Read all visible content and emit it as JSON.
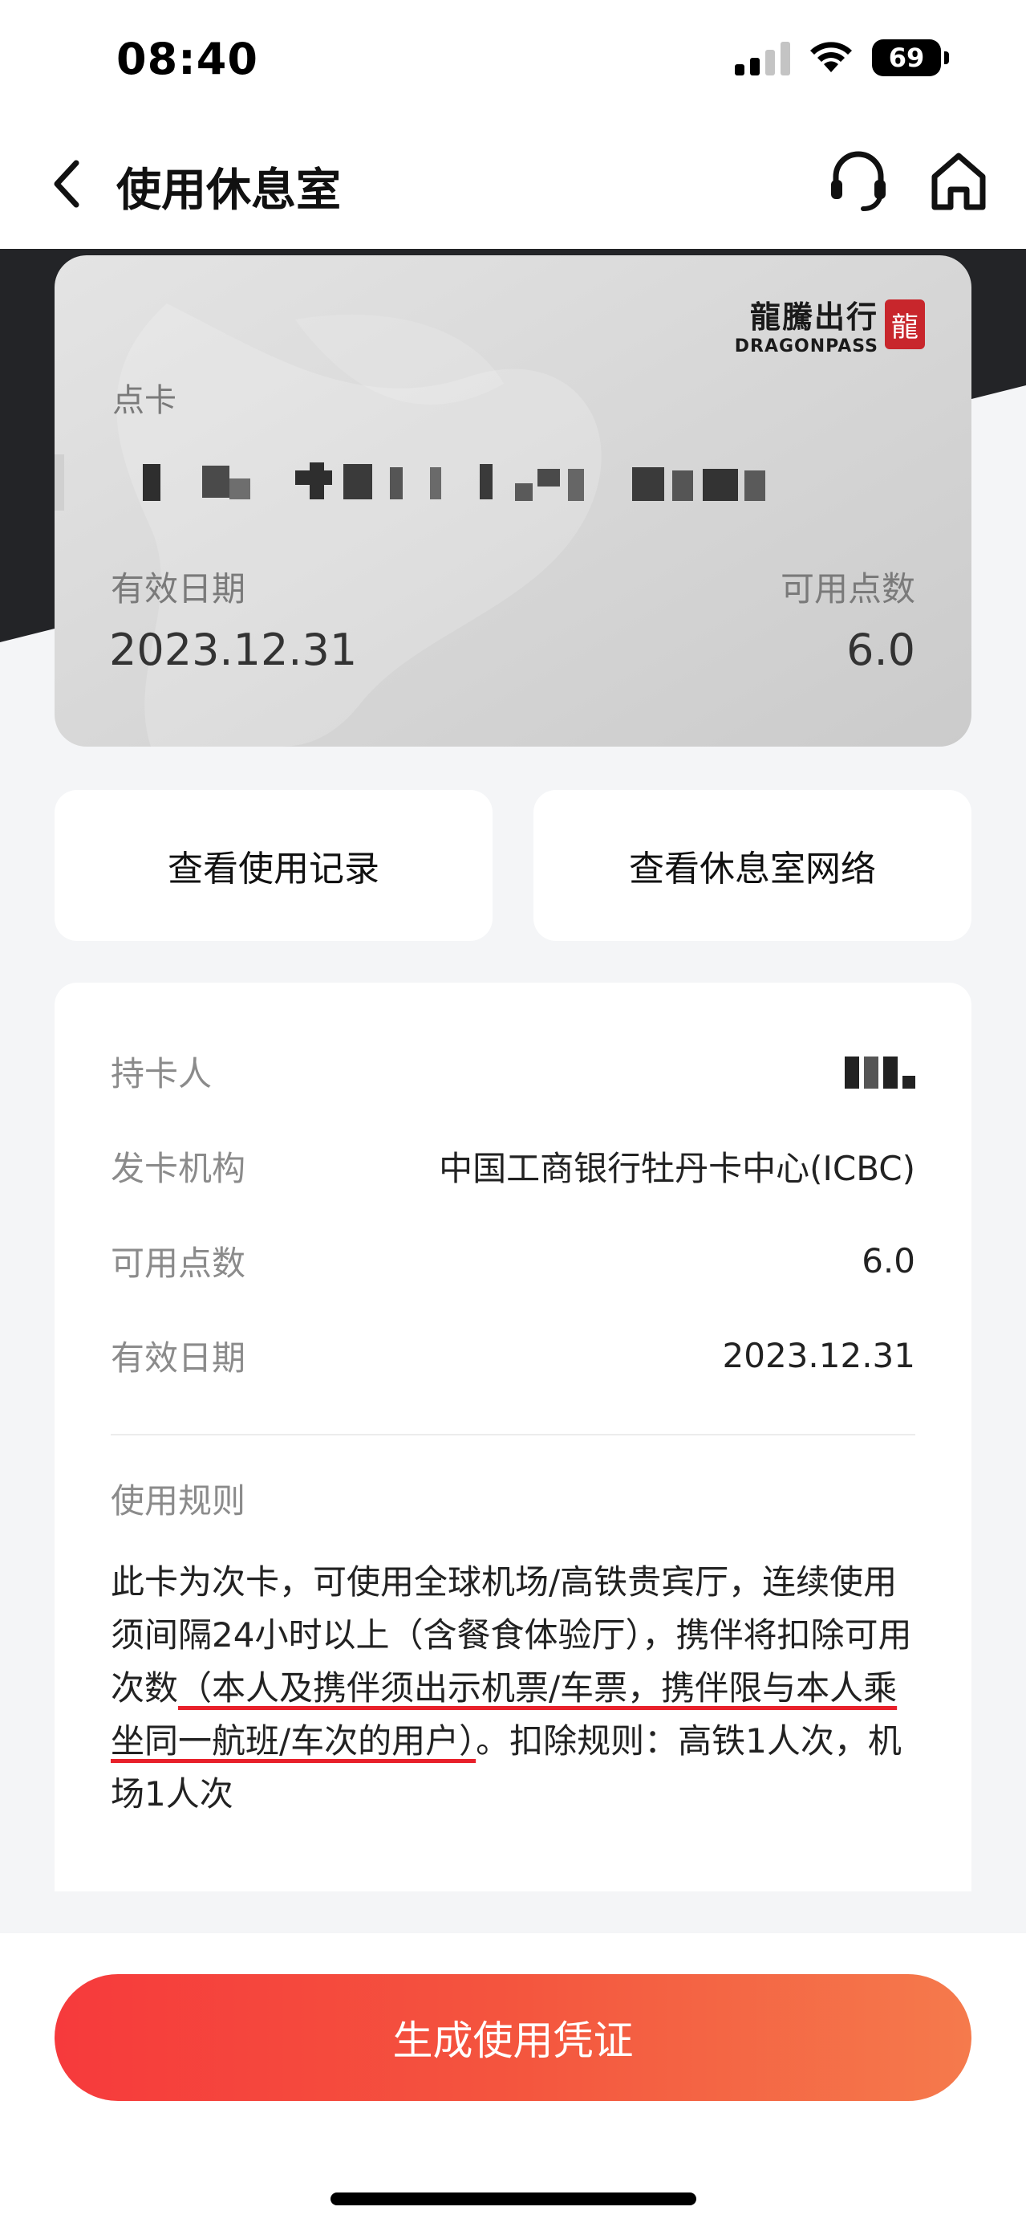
{
  "status_bar": {
    "time": "08:40",
    "battery": "69",
    "icons": [
      "signal-icon",
      "wifi-icon",
      "battery-icon"
    ]
  },
  "nav": {
    "title": "使用休息室",
    "icons": [
      "back-icon",
      "headset-icon",
      "home-icon"
    ]
  },
  "card": {
    "brand_cn": "龍騰出行",
    "brand_en": "DRAGONPASS",
    "brand_seal": "龍",
    "type": "点卡",
    "expiry_label": "有效日期",
    "expiry_value": "2023.12.31",
    "points_label": "可用点数",
    "points_value": "6.0"
  },
  "actions": {
    "usage_history": "查看使用记录",
    "lounge_network": "查看休息室网络"
  },
  "info": {
    "holder_label": "持卡人",
    "issuer_label": "发卡机构",
    "issuer_value": "中国工商银行牡丹卡中心(ICBC)",
    "points_label": "可用点数",
    "points_value": "6.0",
    "expiry_label": "有效日期",
    "expiry_value": "2023.12.31",
    "rules_title": "使用规则",
    "rules_part1": "此卡为次卡，可使用全球机场/高铁贵宾厅，连续使用须间隔24小时以上（含餐食体验厅），携伴将扣除可用次数",
    "rules_highlight": "（本人及携伴须出示机票/车票，携伴限与本人乘坐同一航班/车次的用户）",
    "rules_part2": "。扣除规则：高铁1人次，机场1人次"
  },
  "cta": {
    "label": "生成使用凭证"
  },
  "colors": {
    "accent_start": "#f63a3c",
    "accent_end": "#f57a4c",
    "hero_dark": "#232427",
    "highlight_underline": "#e8202a"
  }
}
